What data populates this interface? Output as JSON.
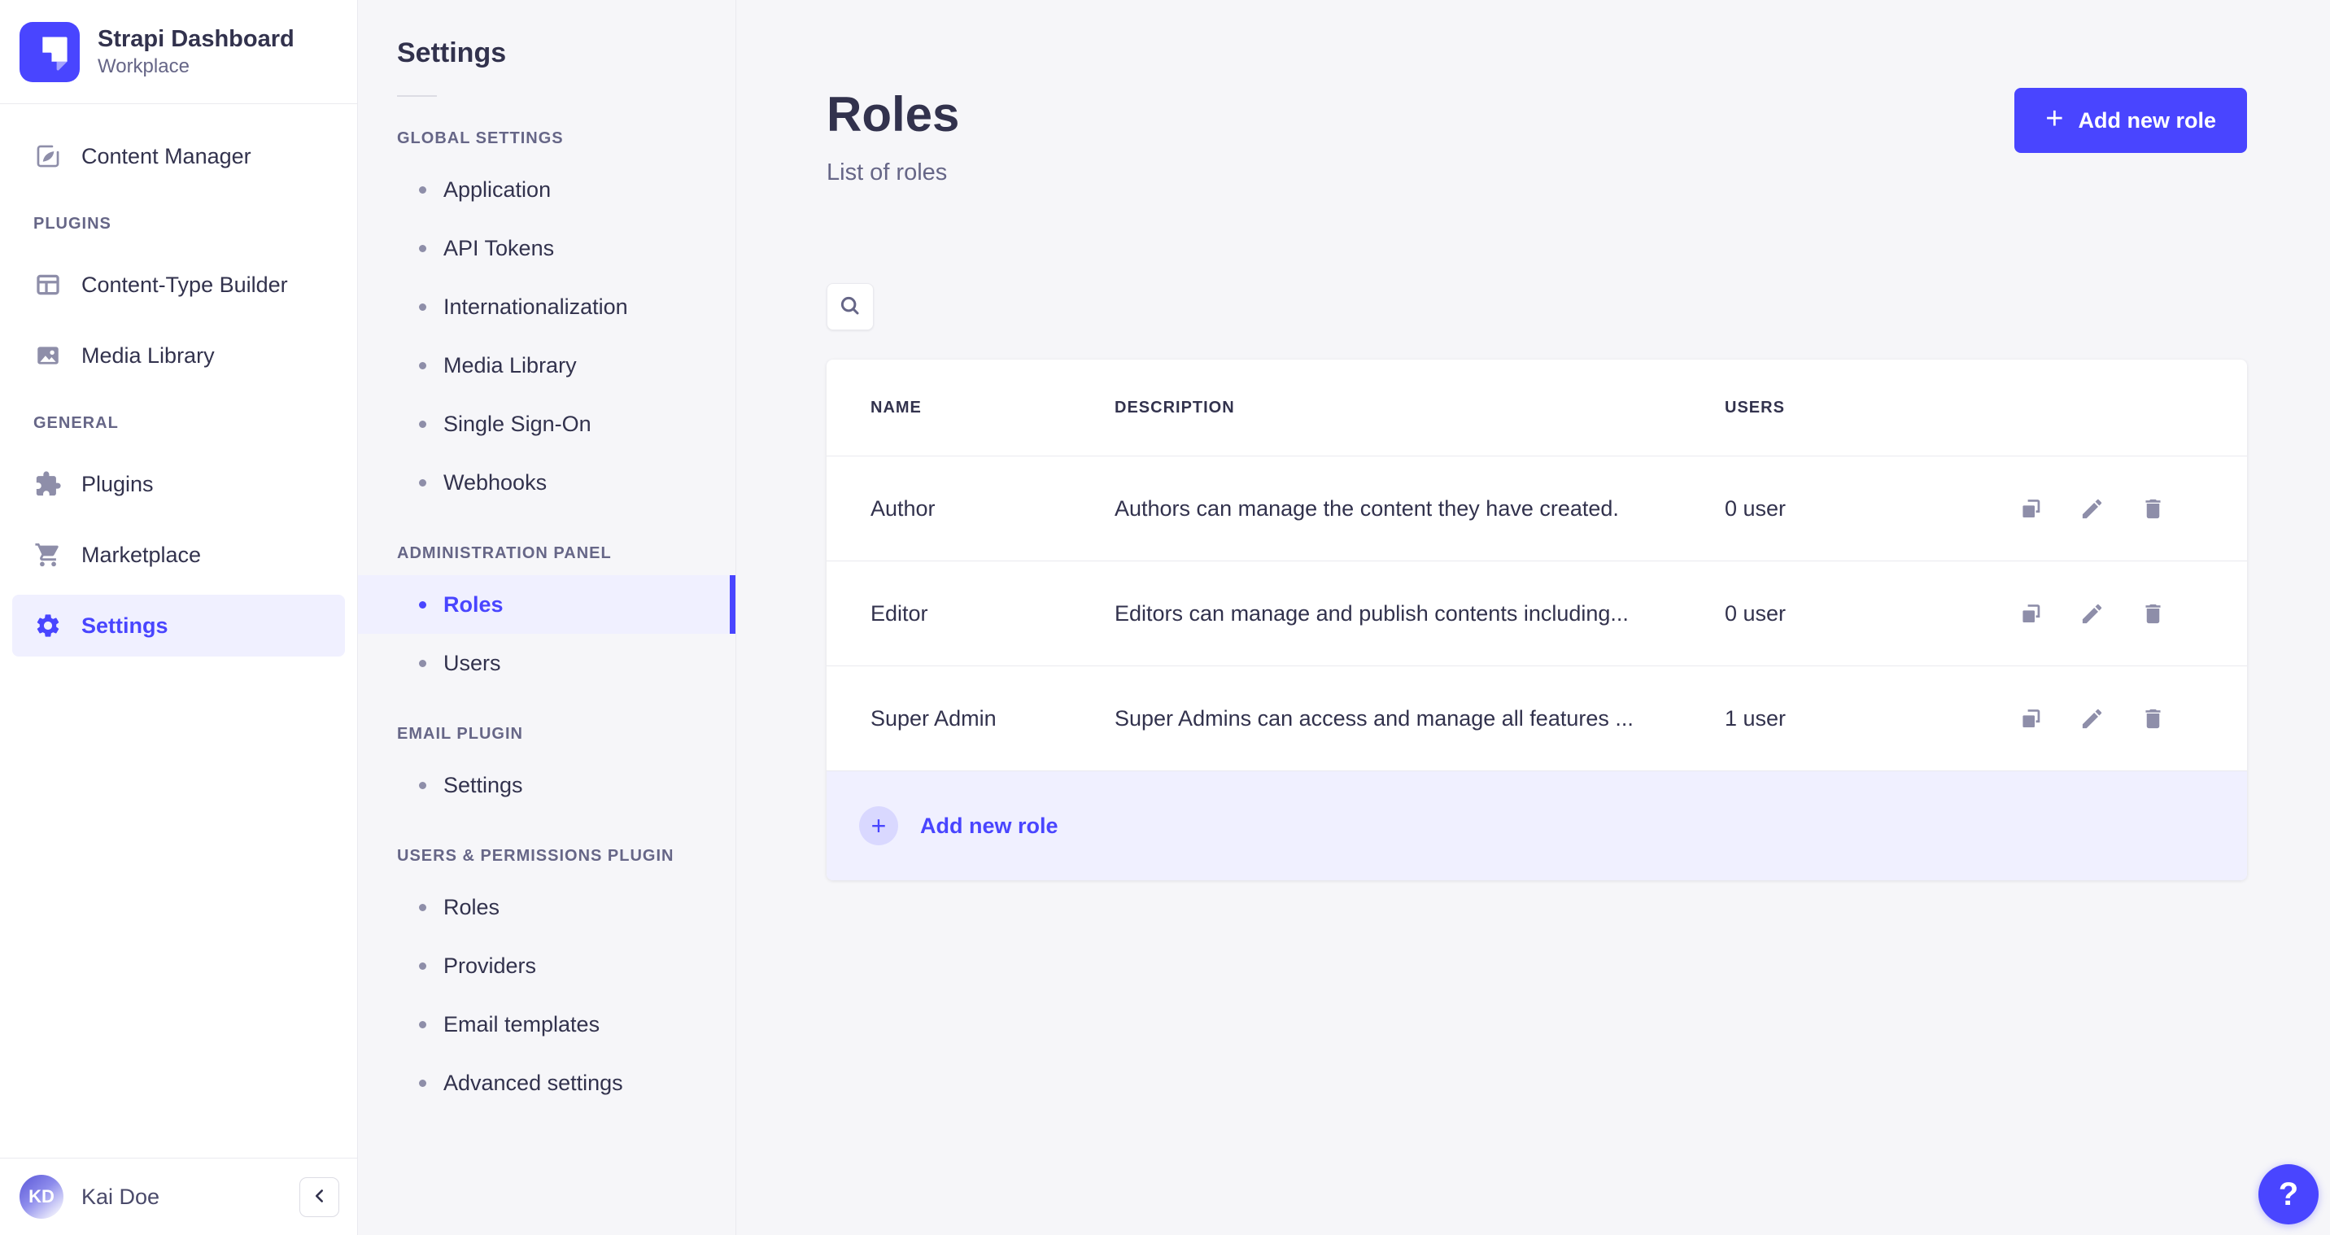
{
  "colors": {
    "accent": "#4945FF",
    "accent_light_bg": "#F0F0FF",
    "sidebar_bg": "#FFFFFF",
    "subnav_bg": "#F6F6F9",
    "content_bg": "#F6F6F9",
    "text_dark": "#32324D",
    "text_gray": "#666687",
    "icon_gray": "#8E8EA9",
    "border": "#EAEAEF"
  },
  "icons": {
    "add": "+",
    "collapse": "chevron-left",
    "search": "magnifier",
    "duplicate": "copy-squares",
    "edit": "pencil",
    "delete": "trash-can"
  },
  "brand": {
    "title": "Strapi Dashboard",
    "subtitle": "Workplace"
  },
  "main_nav": {
    "standalone_item": {
      "label": "Content Manager"
    },
    "sections": [
      {
        "label": "PLUGINS",
        "items": [
          {
            "label": "Content-Type Builder"
          },
          {
            "label": "Media Library"
          }
        ]
      },
      {
        "label": "GENERAL",
        "items": [
          {
            "label": "Plugins"
          },
          {
            "label": "Marketplace"
          },
          {
            "label": "Settings",
            "active": true
          }
        ]
      }
    ],
    "user": {
      "initials": "KD",
      "name": "Kai Doe"
    }
  },
  "settings_nav": {
    "title": "Settings",
    "sections": [
      {
        "label": "GLOBAL SETTINGS",
        "items": [
          {
            "label": "Application"
          },
          {
            "label": "API Tokens"
          },
          {
            "label": "Internationalization"
          },
          {
            "label": "Media Library"
          },
          {
            "label": "Single Sign-On"
          },
          {
            "label": "Webhooks"
          }
        ]
      },
      {
        "label": "ADMINISTRATION PANEL",
        "items": [
          {
            "label": "Roles",
            "active": true
          },
          {
            "label": "Users"
          }
        ]
      },
      {
        "label": "EMAIL PLUGIN",
        "items": [
          {
            "label": "Settings"
          }
        ]
      },
      {
        "label": "USERS & PERMISSIONS PLUGIN",
        "items": [
          {
            "label": "Roles"
          },
          {
            "label": "Providers"
          },
          {
            "label": "Email templates"
          },
          {
            "label": "Advanced settings"
          }
        ]
      }
    ]
  },
  "page": {
    "title": "Roles",
    "subtitle": "List of roles",
    "add_button_label": "Add new role",
    "help_label": "?",
    "table": {
      "headers": {
        "name": "NAME",
        "description": "DESCRIPTION",
        "users": "USERS"
      },
      "rows": [
        {
          "name": "Author",
          "description": "Authors can manage the content they have created.",
          "users": "0 user"
        },
        {
          "name": "Editor",
          "description": "Editors can manage and publish contents including...",
          "users": "0 user"
        },
        {
          "name": "Super Admin",
          "description": "Super Admins can access and manage all features ...",
          "users": "1 user"
        }
      ],
      "footer_add_label": "Add new role"
    }
  }
}
